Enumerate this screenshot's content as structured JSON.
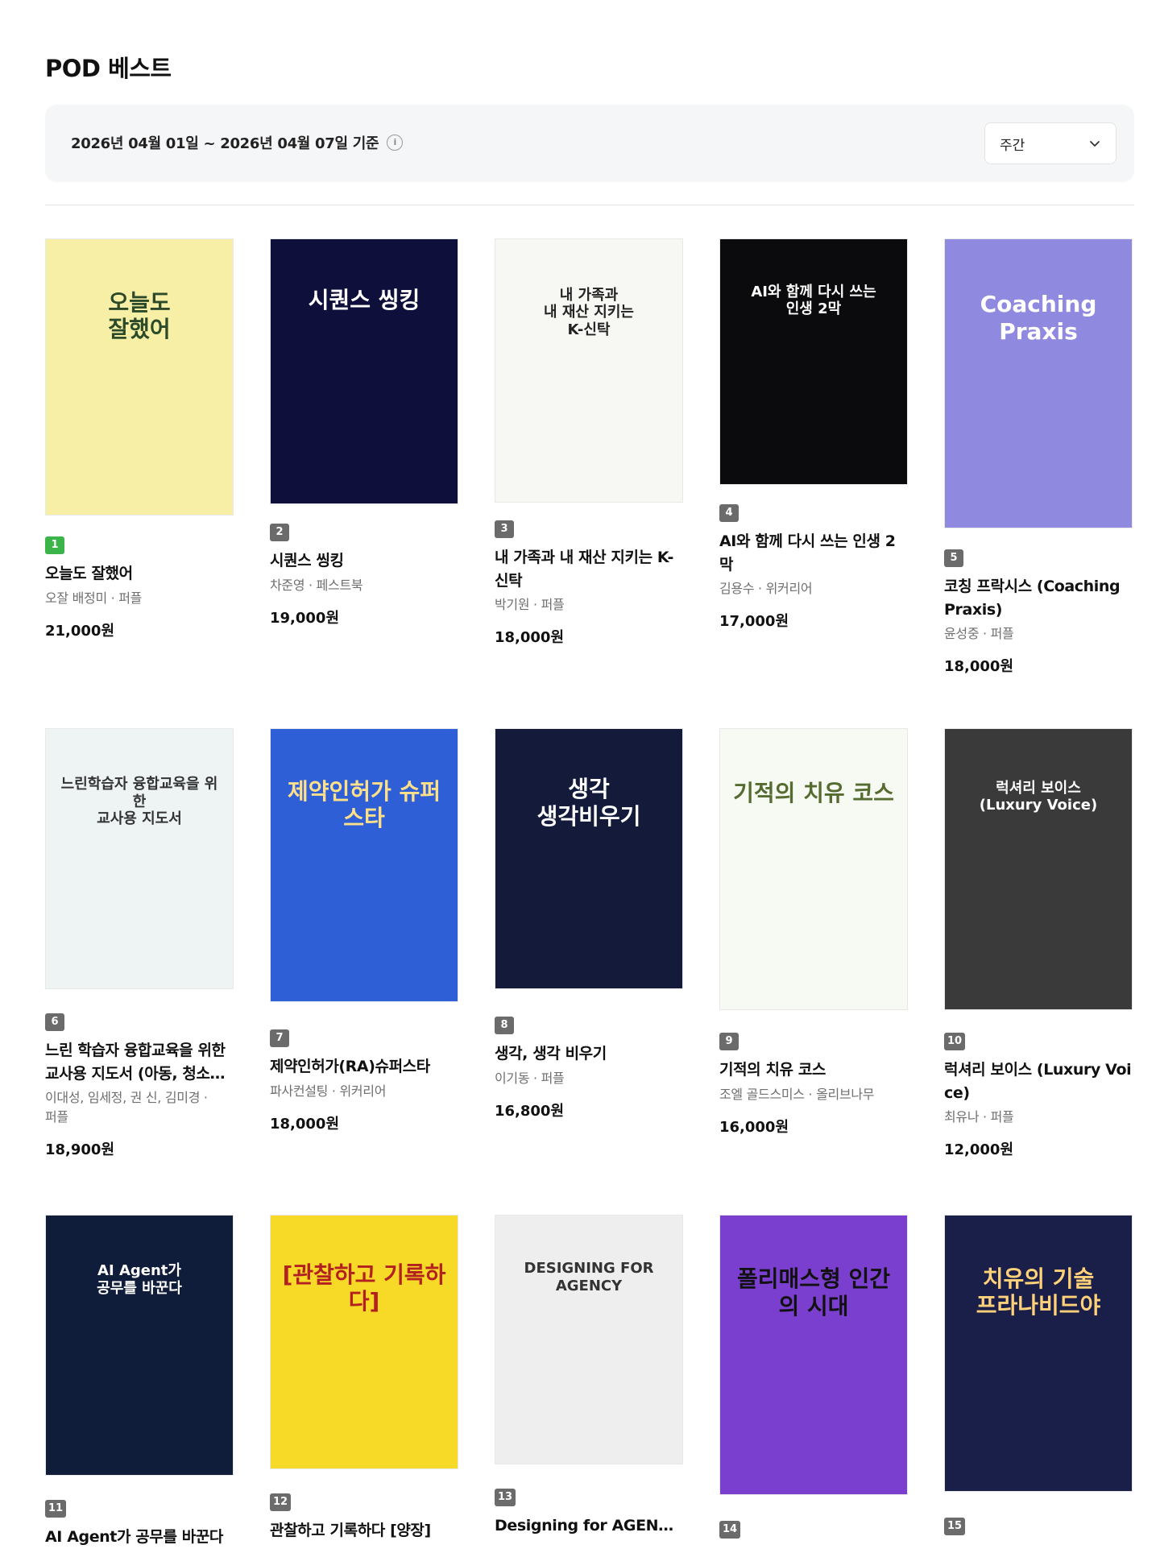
{
  "page": {
    "title": "POD 베스트"
  },
  "filter": {
    "date_range": "2026년 04월 01일 ~ 2026년 04월 07일 기준",
    "info_glyph": "i",
    "period_selected": "주간",
    "chevron_icon": "chevron-down-icon"
  },
  "books": [
    {
      "rank": "1",
      "title": "오늘도 잘했어",
      "meta": "오잘 배정미 · 퍼플",
      "price": "21,000원",
      "cover_text": "오늘도\n잘했어",
      "cover_bg": "#f6efa5",
      "cover_fg": "#2c4a2a"
    },
    {
      "rank": "2",
      "title": "시퀀스 씽킹",
      "meta": "차준영 · 페스트북",
      "price": "19,000원",
      "cover_text": "시퀀스 씽킹",
      "cover_bg": "#0e0f3a",
      "cover_fg": "#ffffff"
    },
    {
      "rank": "3",
      "title": "내 가족과 내 재산 지키는 K-신탁",
      "meta": "박기원 · 퍼플",
      "price": "18,000원",
      "cover_text": "내 가족과\n내 재산 지키는\nK-신탁",
      "cover_bg": "#f7f7f4",
      "cover_fg": "#222222"
    },
    {
      "rank": "4",
      "title": "AI와 함께 다시 쓰는 인생 2막",
      "meta": "김용수 · 위커리어",
      "price": "17,000원",
      "cover_text": "AI와 함께 다시 쓰는\n인생 2막",
      "cover_bg": "#0b0b0d",
      "cover_fg": "#ffffff"
    },
    {
      "rank": "5",
      "title": "코칭 프락시스 (Coaching Praxis)",
      "meta": "윤성중 · 퍼플",
      "price": "18,000원",
      "cover_text": "Coaching\nPraxis",
      "cover_bg": "#8f8ae0",
      "cover_fg": "#ffffff"
    },
    {
      "rank": "6",
      "title": "느린 학습자 융합교육을 위한 교사용 지도서 (아동, 청소년 편)",
      "meta": "이대성, 임세정, 권 신, 김미경 · 퍼플",
      "price": "18,900원",
      "cover_text": "느린학습자 융합교육을 위한\n교사용 지도서",
      "cover_bg": "#eef4f4",
      "cover_fg": "#333333"
    },
    {
      "rank": "7",
      "title": "제약인허가(RA)슈퍼스타",
      "meta": "파사컨설팅 · 위커리어",
      "price": "18,000원",
      "cover_text": "제약인허가 슈퍼스타",
      "cover_bg": "#2f5fd6",
      "cover_fg": "#ffe08a"
    },
    {
      "rank": "8",
      "title": "생각, 생각 비우기",
      "meta": "이기동 · 퍼플",
      "price": "16,800원",
      "cover_text": "생각\n생각비우기",
      "cover_bg": "#141a3a",
      "cover_fg": "#ffffff"
    },
    {
      "rank": "9",
      "title": "기적의 치유 코스",
      "meta": "조엘 골드스미스 · 올리브나무",
      "price": "16,000원",
      "cover_text": "기적의 치유 코스",
      "cover_bg": "#f7faf3",
      "cover_fg": "#556b2f"
    },
    {
      "rank": "10",
      "title": "럭셔리 보이스 (Luxury Voice)",
      "meta": "최유나 · 퍼플",
      "price": "12,000원",
      "cover_text": "럭셔리 보이스\n(Luxury Voice)",
      "cover_bg": "#3a3a3a",
      "cover_fg": "#ffffff"
    },
    {
      "rank": "11",
      "title": "AI Agent가 공무를 바꾼다",
      "meta": "",
      "price": "",
      "cover_text": "AI Agent가\n공무를 바꾼다",
      "cover_bg": "#0f1c3a",
      "cover_fg": "#ffffff"
    },
    {
      "rank": "12",
      "title": "관찰하고 기록하다 [양장]",
      "meta": "",
      "price": "",
      "cover_text": "[관찰하고 기록하다]",
      "cover_bg": "#f7d928",
      "cover_fg": "#b32020"
    },
    {
      "rank": "13",
      "title": "Designing for AGENCY [컬러]",
      "meta": "",
      "price": "",
      "cover_text": "DESIGNING FOR\nAGENCY",
      "cover_bg": "#eeeeee",
      "cover_fg": "#333333"
    },
    {
      "rank": "14",
      "title": "",
      "meta": "",
      "price": "",
      "cover_text": "폴리매스형 인간의 시대",
      "cover_bg": "#7b3fd0",
      "cover_fg": "#111111"
    },
    {
      "rank": "15",
      "title": "",
      "meta": "",
      "price": "",
      "cover_text": "치유의 기술\n프라나비드야",
      "cover_bg": "#1a1f4a",
      "cover_fg": "#ffd27a"
    }
  ]
}
